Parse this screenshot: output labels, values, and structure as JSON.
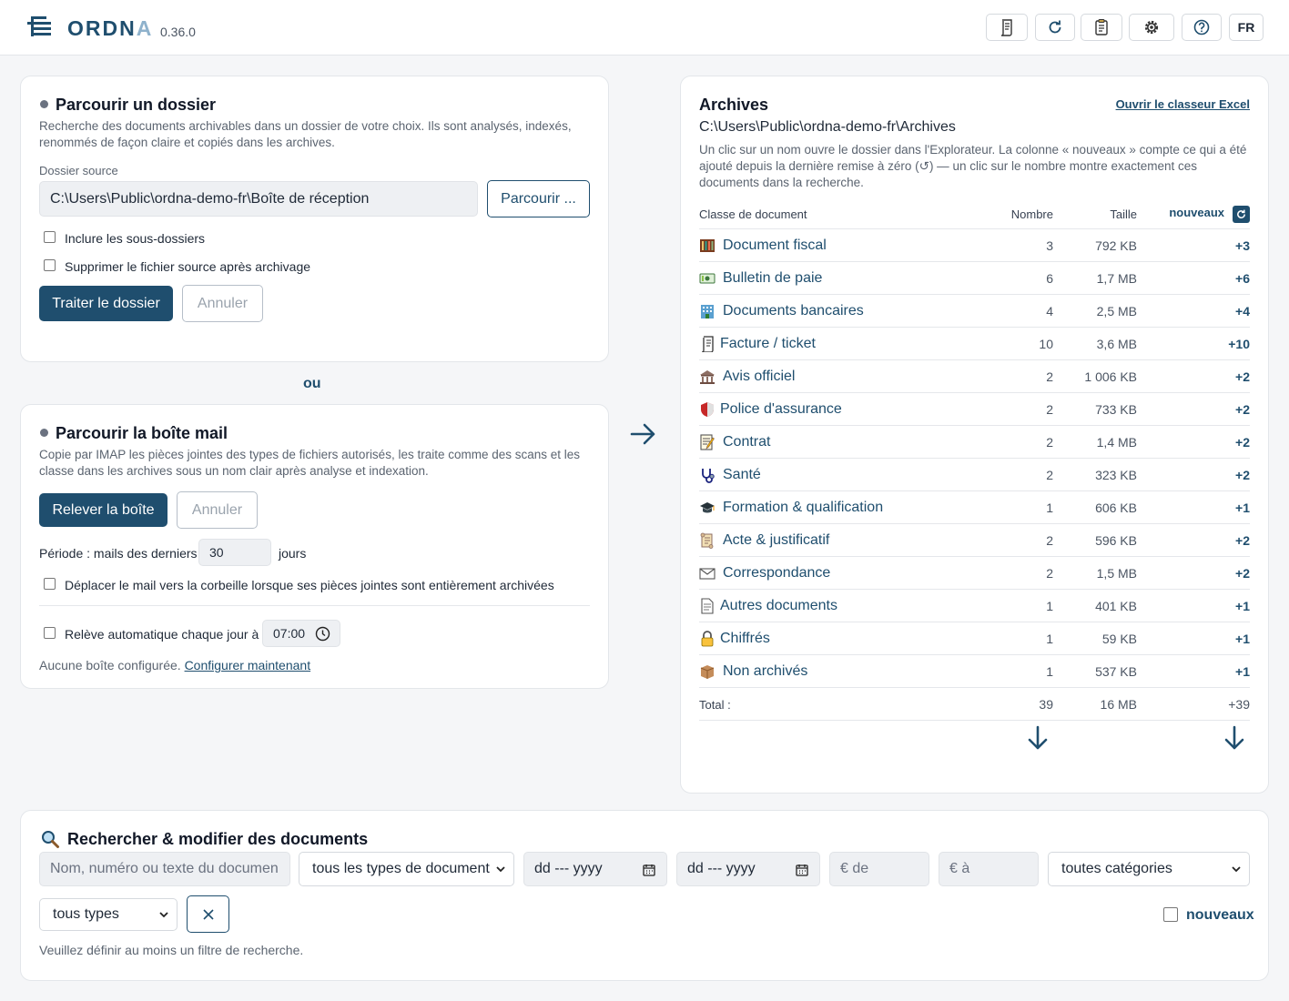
{
  "header": {
    "app_name_main": "ORDN",
    "app_name_fade": "A",
    "version": "0.36.0",
    "lang": "FR"
  },
  "folder_card": {
    "title": "Parcourir un dossier",
    "description": "Recherche des documents archivables dans un dossier de votre choix. Ils sont analysés, indexés, renommés de façon claire et copiés dans les archives.",
    "source_label": "Dossier source",
    "source_value": "C:\\Users\\Public\\ordna-demo-fr\\Boîte de réception",
    "browse_label": "Parcourir ...",
    "include_sub_label": "Inclure les sous-dossiers",
    "delete_source_label": "Supprimer le fichier source après archivage",
    "process_label": "Traiter le dossier",
    "cancel_label": "Annuler"
  },
  "or_label": "ou",
  "mail_card": {
    "title": "Parcourir la boîte mail",
    "description": "Copie par IMAP les pièces jointes des types de fichiers autorisés, les traite comme des scans et les classe dans les archives sous un nom clair après analyse et indexation.",
    "fetch_label": "Relever la boîte",
    "cancel_label": "Annuler",
    "period_label": "Période : mails des derniers",
    "period_value": "30",
    "period_unit": "jours",
    "trash_label": "Déplacer le mail vers la corbeille lorsque ses pièces jointes sont entièrement archivées",
    "auto_label": "Relève automatique chaque jour à",
    "auto_time": "07:00",
    "no_box_text": "Aucune boîte configurée.",
    "configure_link": "Configurer maintenant"
  },
  "archives": {
    "title": "Archives",
    "excel_link": "Ouvrir le classeur Excel",
    "path": "C:\\Users\\Public\\ordna-demo-fr\\Archives",
    "description": "Un clic sur un nom ouvre le dossier dans l'Explorateur. La colonne « nouveaux » compte ce qui a été ajouté depuis la dernière remise à zéro (↺) — un clic sur le nombre montre exactement ces documents dans la recherche.",
    "col_class": "Classe de document",
    "col_count": "Nombre",
    "col_size": "Taille",
    "col_new": "nouveaux",
    "rows": [
      {
        "icon": "tax-document-icon",
        "name": "Document fiscal",
        "count": "3",
        "size": "792 KB",
        "new": "+3"
      },
      {
        "icon": "payslip-icon",
        "name": "Bulletin de paie",
        "count": "6",
        "size": "1,7 MB",
        "new": "+6"
      },
      {
        "icon": "bank-icon",
        "name": "Documents bancaires",
        "count": "4",
        "size": "2,5 MB",
        "new": "+4"
      },
      {
        "icon": "receipt-icon",
        "name": "Facture / ticket",
        "count": "10",
        "size": "3,6 MB",
        "new": "+10"
      },
      {
        "icon": "government-icon",
        "name": "Avis officiel",
        "count": "2",
        "size": "1 006 KB",
        "new": "+2"
      },
      {
        "icon": "shield-icon",
        "name": "Police d'assurance",
        "count": "2",
        "size": "733 KB",
        "new": "+2"
      },
      {
        "icon": "contract-icon",
        "name": "Contrat",
        "count": "2",
        "size": "1,4 MB",
        "new": "+2"
      },
      {
        "icon": "stethoscope-icon",
        "name": "Santé",
        "count": "2",
        "size": "323 KB",
        "new": "+2"
      },
      {
        "icon": "graduation-cap-icon",
        "name": "Formation & qualification",
        "count": "1",
        "size": "606 KB",
        "new": "+1"
      },
      {
        "icon": "scroll-icon",
        "name": "Acte & justificatif",
        "count": "2",
        "size": "596 KB",
        "new": "+2"
      },
      {
        "icon": "envelope-icon",
        "name": "Correspondance",
        "count": "2",
        "size": "1,5 MB",
        "new": "+2"
      },
      {
        "icon": "page-icon",
        "name": "Autres documents",
        "count": "1",
        "size": "401 KB",
        "new": "+1"
      },
      {
        "icon": "lock-icon",
        "name": "Chiffrés",
        "count": "1",
        "size": "59 KB",
        "new": "+1"
      },
      {
        "icon": "box-icon",
        "name": "Non archivés",
        "count": "1",
        "size": "537 KB",
        "new": "+1"
      }
    ],
    "total_label": "Total :",
    "total_count": "39",
    "total_size": "16 MB",
    "total_new": "+39"
  },
  "search": {
    "title": "Rechercher & modifier des documents",
    "query_placeholder": "Nom, numéro ou texte du documen",
    "doc_type_value": "tous les types de document",
    "date_from_placeholder": "dd --- yyyy",
    "date_to_placeholder": "dd --- yyyy",
    "amount_from_placeholder": "€ de",
    "amount_to_placeholder": "€ à",
    "category_value": "toutes catégories",
    "type_value": "tous types",
    "new_label": "nouveaux",
    "hint": "Veuillez définir au moins un filtre de recherche."
  },
  "colors": {
    "accent": "#1f4e6e",
    "background": "#f5f6f8"
  }
}
